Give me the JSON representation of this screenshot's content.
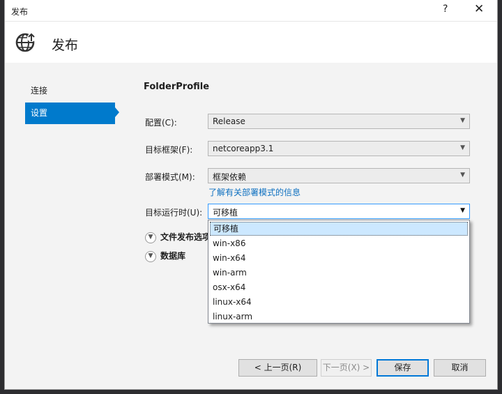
{
  "window": {
    "title": "发布",
    "help_label": "?",
    "close_label": "✕"
  },
  "header": {
    "title": "发布",
    "icon": "publish-globe-icon"
  },
  "sidebar": {
    "items": [
      {
        "label": "连接"
      },
      {
        "label": "设置"
      }
    ],
    "active": "设置"
  },
  "main": {
    "profile_name": "FolderProfile",
    "configuration": {
      "label": "配置(C):",
      "value": "Release"
    },
    "target_framework": {
      "label": "目标框架(F):",
      "value": "netcoreapp3.1"
    },
    "deployment_mode": {
      "label": "部署模式(M):",
      "value": "框架依赖",
      "link": "了解有关部署模式的信息"
    },
    "target_runtime": {
      "label": "目标运行时(U):",
      "value": "可移植",
      "options": [
        "可移植",
        "win-x86",
        "win-x64",
        "win-arm",
        "osx-x64",
        "linux-x64",
        "linux-arm"
      ]
    },
    "sections": [
      {
        "label": "文件发布选项"
      },
      {
        "label": "数据库"
      }
    ]
  },
  "footer": {
    "prev_label": "< 上一页(R)",
    "next_label": "下一页(X) >",
    "save_label": "保存",
    "cancel_label": "取消"
  },
  "colors": {
    "accent": "#007acc",
    "link": "#0e70c0",
    "selection": "#cce8ff"
  }
}
